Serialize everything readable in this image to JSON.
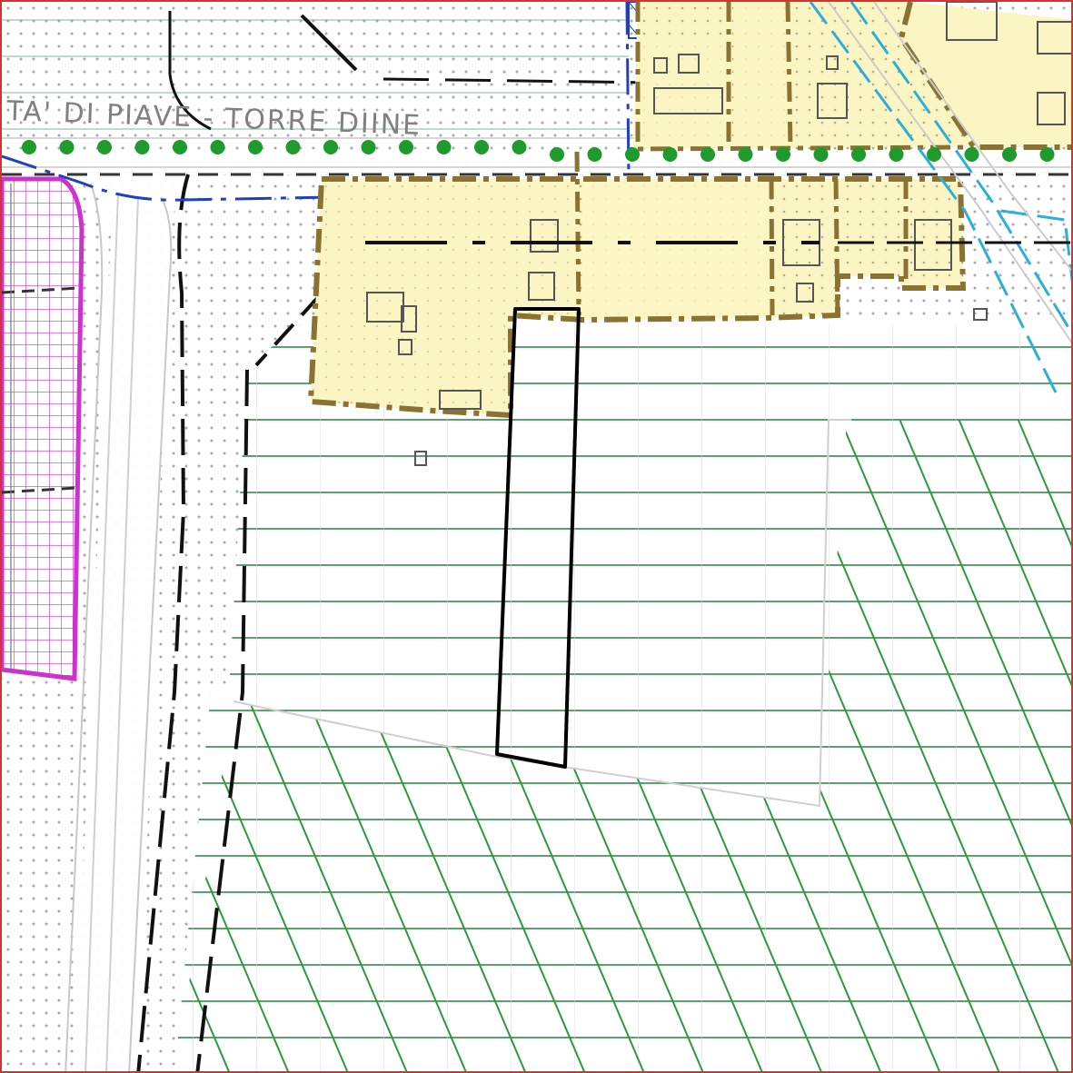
{
  "map": {
    "road_label": "TA'  DI  PIAVE  -  TORRE  DIINE"
  },
  "colors": {
    "frame_border": "#d93030",
    "settlement_fill": "#fbf5c4",
    "settlement_border": "#8a7233",
    "green_hatch": "#2a9a3c",
    "green_lines": "#5aa070",
    "tree_dots": "#1f9a2c",
    "magenta_zone": "#cc33cc",
    "blue_boundary": "#2040c0",
    "cyan_canal": "#2ab0d8",
    "dot_pattern": "#a8a8a8",
    "road_label_color": "#808080",
    "plot_outline": "#000000"
  },
  "legend_features": [
    "dotted-agricultural-zone",
    "residential-settlement",
    "green-hatched-zone",
    "magenta-grid-zone",
    "tree-row",
    "highlighted-plot"
  ]
}
